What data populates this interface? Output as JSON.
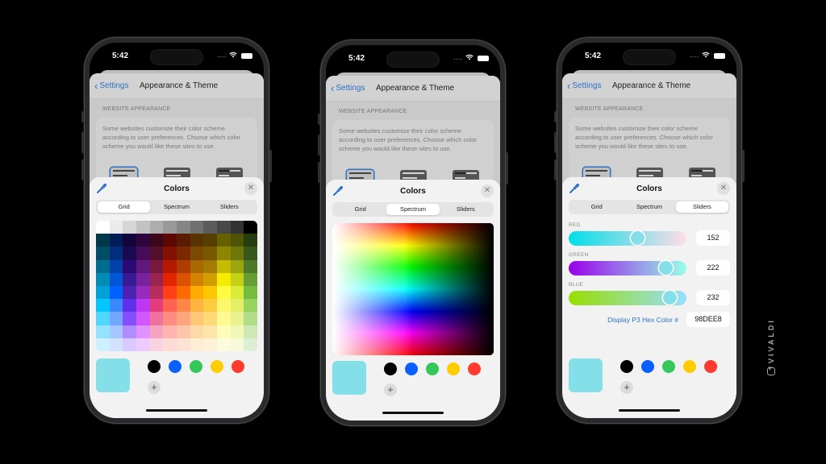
{
  "status_bar": {
    "time": "5:42",
    "signal": "...."
  },
  "settings_screen": {
    "back_label": "Settings",
    "title": "Appearance & Theme",
    "section_header": "WEBSITE APPEARANCE",
    "description": "Some websites customize their color scheme according to user preferences. Choose which color scheme you would like these sites to use.",
    "scheme_options": [
      "light",
      "dark",
      "auto"
    ],
    "selected_scheme": "light"
  },
  "color_sheet": {
    "title": "Colors",
    "tabs": [
      "Grid",
      "Spectrum",
      "Sliders"
    ],
    "close_icon": "close-icon",
    "eyedropper_icon": "eyedropper-icon",
    "current_color": "#85dfe9",
    "favorites": [
      "#000000",
      "#0a60ff",
      "#34c759",
      "#ffcc00",
      "#ff3b30"
    ],
    "add_label": "+"
  },
  "phones": [
    {
      "active_tab": "Grid"
    },
    {
      "active_tab": "Spectrum"
    },
    {
      "active_tab": "Sliders"
    }
  ],
  "grid_palette": [
    [
      "#ffffff",
      "#ebebeb",
      "#d6d6d6",
      "#c2c2c2",
      "#adadad",
      "#999999",
      "#858585",
      "#707070",
      "#5c5c5c",
      "#474747",
      "#333333",
      "#000000"
    ],
    [
      "#00374a",
      "#011d57",
      "#11053b",
      "#2e063d",
      "#3c071b",
      "#5c0701",
      "#5a1c00",
      "#583300",
      "#563d00",
      "#666100",
      "#4f5504",
      "#263e0f"
    ],
    [
      "#004d65",
      "#012f7b",
      "#1a0a52",
      "#450d59",
      "#551029",
      "#831100",
      "#7b2900",
      "#7a4a00",
      "#785800",
      "#8c8602",
      "#6f760a",
      "#38571a"
    ],
    [
      "#016e8f",
      "#0042a9",
      "#2c0977",
      "#61187c",
      "#791a3d",
      "#b51a00",
      "#ad3e00",
      "#a96800",
      "#a67b01",
      "#c4bc00",
      "#9ba50e",
      "#4e7a27"
    ],
    [
      "#008cb4",
      "#0056d6",
      "#371a94",
      "#7a219e",
      "#99244f",
      "#e22400",
      "#da5100",
      "#d38301",
      "#d19d01",
      "#f5ec00",
      "#c3d117",
      "#669d34"
    ],
    [
      "#00a1d8",
      "#0061fe",
      "#4d22b2",
      "#982abc",
      "#b92d5d",
      "#ff4015",
      "#ff6a00",
      "#ffab01",
      "#fdc700",
      "#fefb41",
      "#d9ec37",
      "#76bb40"
    ],
    [
      "#01c7fc",
      "#3a87fe",
      "#5e30eb",
      "#be38f3",
      "#e63b7a",
      "#fe6250",
      "#fe8648",
      "#feb43f",
      "#fecb3e",
      "#fff76b",
      "#e4ef65",
      "#96d35f"
    ],
    [
      "#52d6fc",
      "#74a7ff",
      "#864ffe",
      "#d357fe",
      "#ee719e",
      "#ff8c82",
      "#fea57d",
      "#fec777",
      "#fed977",
      "#fff994",
      "#eaf28f",
      "#b1dd8b"
    ],
    [
      "#93e3fc",
      "#a7c6ff",
      "#b18cfe",
      "#e292fe",
      "#f4a4c0",
      "#ffb5af",
      "#ffc5ab",
      "#fed9a8",
      "#fde4a8",
      "#fffbb9",
      "#f1f7b7",
      "#cde8b5"
    ],
    [
      "#cbf0ff",
      "#d3e2ff",
      "#d9c9fe",
      "#efcaff",
      "#f9d3e0",
      "#ffdbd8",
      "#ffe2d6",
      "#feecd4",
      "#fef1d5",
      "#fdfbdd",
      "#f6fadb",
      "#deeed4"
    ]
  ],
  "sliders": {
    "channels": [
      {
        "label": "RED",
        "value": "152",
        "fraction": 0.596,
        "gradient_from": "#00dee8",
        "gradient_to": "#ffdee8"
      },
      {
        "label": "GREEN",
        "value": "222",
        "fraction": 0.871,
        "gradient_from": "#9800e8",
        "gradient_to": "#98ffe8"
      },
      {
        "label": "BLUE",
        "value": "232",
        "fraction": 0.91,
        "gradient_from": "#98de00",
        "gradient_to": "#98deff"
      }
    ],
    "hex_label": "Display P3 Hex Color #",
    "hex_value": "98DEE8"
  },
  "brand": {
    "name": "VIVALDI"
  }
}
